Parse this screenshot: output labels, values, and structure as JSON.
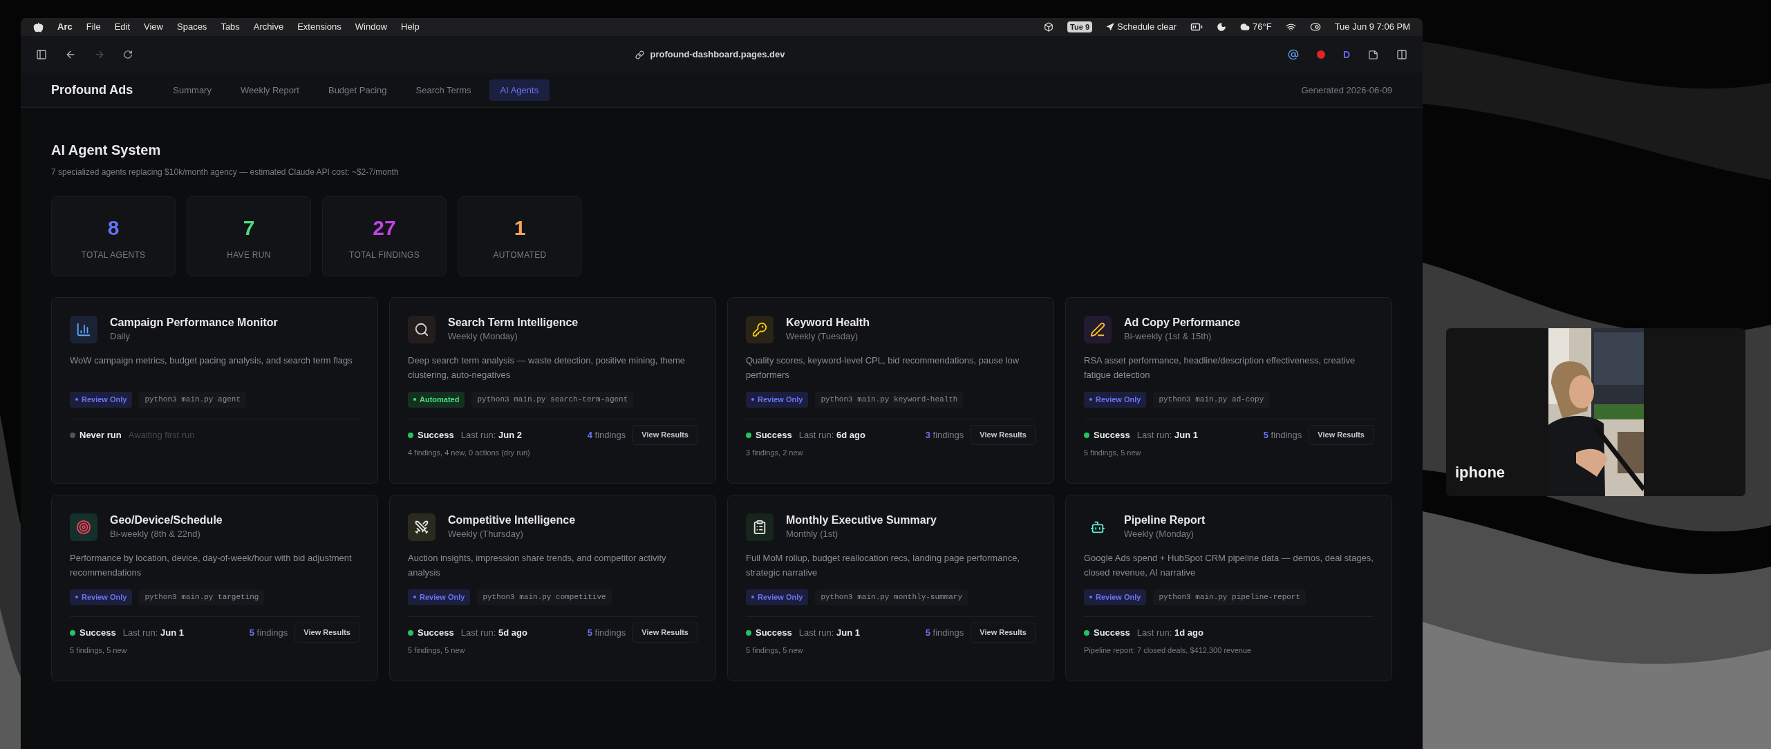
{
  "menu_bar": {
    "app_name": "Arc",
    "menus": [
      "File",
      "Edit",
      "View",
      "Spaces",
      "Tabs",
      "Archive",
      "Extensions",
      "Window",
      "Help"
    ],
    "calendar_badge": "Tue 9",
    "focus": "Schedule clear",
    "weather": "76°F",
    "clock": "Tue Jun 9 7:06 PM"
  },
  "browser": {
    "url": "profound-dashboard.pages.dev",
    "forward_disabled": true,
    "profile_letter": "D"
  },
  "nav": {
    "brand": "Profound Ads",
    "tabs": [
      {
        "label": "Summary",
        "selected": false
      },
      {
        "label": "Weekly Report",
        "selected": false
      },
      {
        "label": "Budget Pacing",
        "selected": false
      },
      {
        "label": "Search Terms",
        "selected": false
      },
      {
        "label": "AI Agents",
        "selected": true
      }
    ],
    "generated": "Generated 2026-06-09"
  },
  "page": {
    "title": "AI Agent System",
    "subtitle": "7 specialized agents replacing $10k/month agency — estimated Claude API cost: ~$2-7/month",
    "stats": [
      {
        "value": "8",
        "label": "TOTAL AGENTS",
        "color": "#6272f0"
      },
      {
        "value": "7",
        "label": "HAVE RUN",
        "color": "#4ade80"
      },
      {
        "value": "27",
        "label": "TOTAL FINDINGS",
        "color": "#c243e8"
      },
      {
        "value": "1",
        "label": "AUTOMATED",
        "color": "#f5a35b"
      }
    ],
    "agents": [
      {
        "title": "Campaign Performance Monitor",
        "schedule": "Daily",
        "description": "WoW campaign metrics, budget pacing analysis, and search term flags",
        "mode": {
          "kind": "review",
          "label": "Review Only"
        },
        "command": "python3 main.py agent",
        "status": {
          "kind": "never",
          "label": "Never run"
        },
        "note": "Awaiting first run"
      },
      {
        "title": "Search Term Intelligence",
        "schedule": "Weekly (Monday)",
        "description": "Deep search term analysis — waste detection, positive mining, theme clustering, auto-negatives",
        "mode": {
          "kind": "automated",
          "label": "Automated"
        },
        "command": "python3 main.py search-term-agent",
        "status": {
          "kind": "success",
          "label": "Success"
        },
        "last_run_label": "Last run:",
        "last_run": "Jun 2",
        "findings_count": "4",
        "findings_label": "findings",
        "action": "View Results",
        "summary": "4 findings, 4 new, 0 actions (dry run)"
      },
      {
        "title": "Keyword Health",
        "schedule": "Weekly (Tuesday)",
        "description": "Quality scores, keyword-level CPL, bid recommendations, pause low performers",
        "mode": {
          "kind": "review",
          "label": "Review Only"
        },
        "command": "python3 main.py keyword-health",
        "status": {
          "kind": "success",
          "label": "Success"
        },
        "last_run_label": "Last run:",
        "last_run": "6d ago",
        "findings_count": "3",
        "findings_label": "findings",
        "action": "View Results",
        "summary": "3 findings, 2 new"
      },
      {
        "title": "Ad Copy Performance",
        "schedule": "Bi-weekly (1st & 15th)",
        "description": "RSA asset performance, headline/description effectiveness, creative fatigue detection",
        "mode": {
          "kind": "review",
          "label": "Review Only"
        },
        "command": "python3 main.py ad-copy",
        "status": {
          "kind": "success",
          "label": "Success"
        },
        "last_run_label": "Last run:",
        "last_run": "Jun 1",
        "findings_count": "5",
        "findings_label": "findings",
        "action": "View Results",
        "summary": "5 findings, 5 new"
      },
      {
        "title": "Geo/Device/Schedule",
        "schedule": "Bi-weekly (8th & 22nd)",
        "description": "Performance by location, device, day-of-week/hour with bid adjustment recommendations",
        "mode": {
          "kind": "review",
          "label": "Review Only"
        },
        "command": "python3 main.py targeting",
        "status": {
          "kind": "success",
          "label": "Success"
        },
        "last_run_label": "Last run:",
        "last_run": "Jun 1",
        "findings_count": "5",
        "findings_label": "findings",
        "action": "View Results",
        "summary": "5 findings, 5 new"
      },
      {
        "title": "Competitive Intelligence",
        "schedule": "Weekly (Thursday)",
        "description": "Auction insights, impression share trends, and competitor activity analysis",
        "mode": {
          "kind": "review",
          "label": "Review Only"
        },
        "command": "python3 main.py competitive",
        "status": {
          "kind": "success",
          "label": "Success"
        },
        "last_run_label": "Last run:",
        "last_run": "5d ago",
        "findings_count": "5",
        "findings_label": "findings",
        "action": "View Results",
        "summary": "5 findings, 5 new"
      },
      {
        "title": "Monthly Executive Summary",
        "schedule": "Monthly (1st)",
        "description": "Full MoM rollup, budget reallocation recs, landing page performance, strategic narrative",
        "mode": {
          "kind": "review",
          "label": "Review Only"
        },
        "command": "python3 main.py monthly-summary",
        "status": {
          "kind": "success",
          "label": "Success"
        },
        "last_run_label": "Last run:",
        "last_run": "Jun 1",
        "findings_count": "5",
        "findings_label": "findings",
        "action": "View Results",
        "summary": "5 findings, 5 new"
      },
      {
        "title": "Pipeline Report",
        "schedule": "Weekly (Monday)",
        "description": "Google Ads spend + HubSpot CRM pipeline data — demos, deal stages, closed revenue, AI narrative",
        "mode": {
          "kind": "review",
          "label": "Review Only"
        },
        "command": "python3 main.py pipeline-report",
        "status": {
          "kind": "success",
          "label": "Success"
        },
        "last_run_label": "Last run:",
        "last_run": "1d ago",
        "summary": "Pipeline report: 7 closed deals, $412,300 revenue"
      }
    ]
  },
  "video": {
    "label": "iphone"
  }
}
